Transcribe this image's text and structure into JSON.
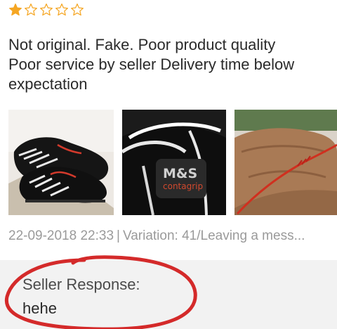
{
  "review": {
    "rating": 1,
    "max_rating": 5,
    "star_color": "#f5a623",
    "text_lines": [
      "Not original. Fake. Poor product quality",
      "Poor service by seller  Delivery time below",
      "expectation"
    ],
    "photos": [
      {
        "icon": "shoes-photo"
      },
      {
        "icon": "shoe-closeup-photo",
        "label": "M&S",
        "sublabel": "contagrip"
      },
      {
        "icon": "red-lace-photo"
      }
    ],
    "meta": {
      "datetime": "22-09-2018 22:33",
      "separator": "|",
      "variation": "Variation: 41/Leaving a mess..."
    }
  },
  "seller_response": {
    "title": "Seller Response:",
    "reply": "hehe",
    "highlight_color": "#d42a2a"
  }
}
